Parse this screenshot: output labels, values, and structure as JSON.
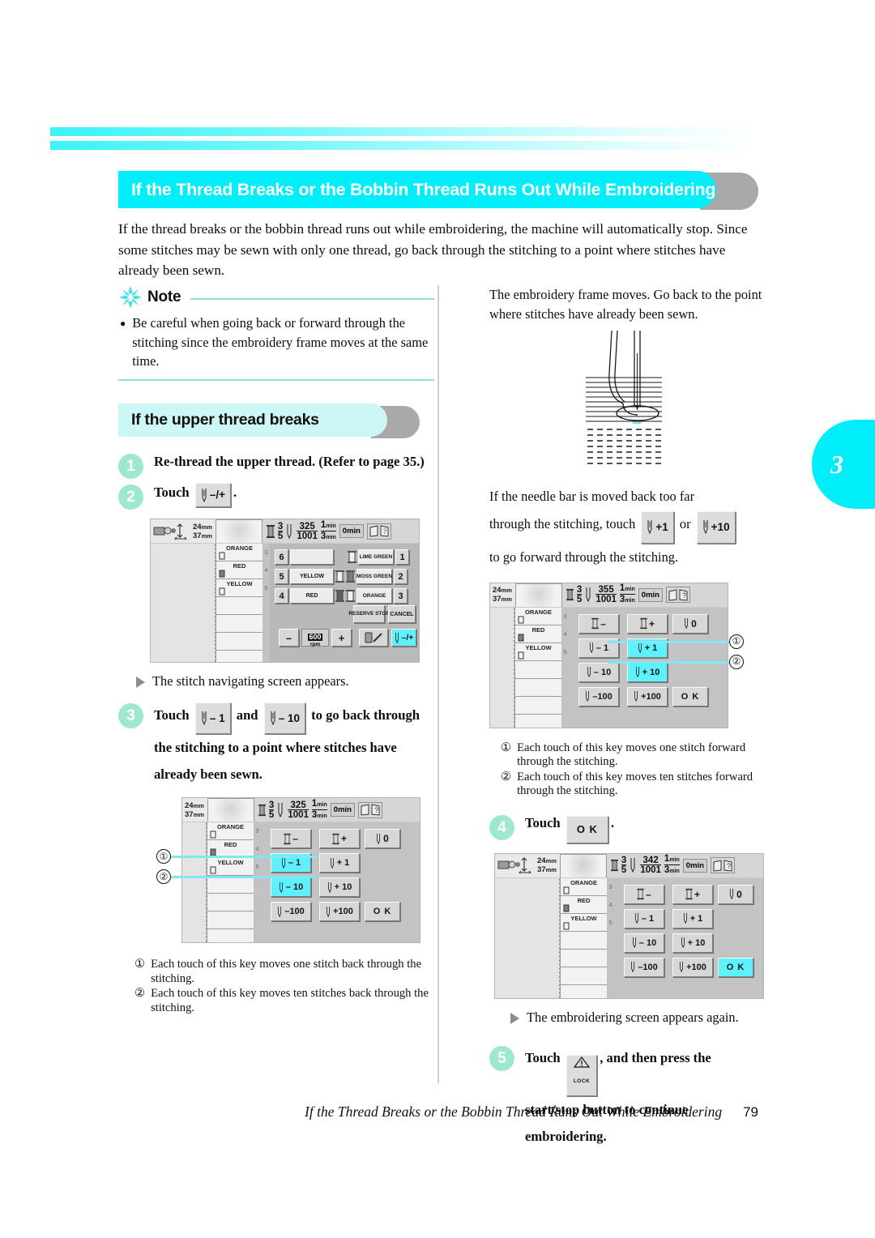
{
  "section": {
    "heading": "If the Thread Breaks or the Bobbin Thread Runs Out While Embroidering",
    "intro": "If the thread breaks or the bobbin thread runs out while embroidering, the machine will automatically stop. Since some stitches may be sewn with only one thread, go back through the stitching to a point where stitches have already been sewn."
  },
  "note": {
    "title": "Note",
    "bullet": "●",
    "text": "Be careful when going back or forward through the stitching since the embroidery frame moves at the same time."
  },
  "subsection": {
    "heading": "If the upper thread breaks"
  },
  "steps": {
    "one": {
      "num": "1",
      "text": "Re-thread the upper thread. (Refer to page 35.)"
    },
    "two": {
      "num": "2",
      "prefix": "Touch",
      "key": "–/+",
      "suffix": "."
    },
    "three": {
      "num": "3",
      "prefix": "Touch",
      "key_a": "– 1",
      "mid": "and",
      "key_b": "– 10",
      "suffix": "to go back through the stitching to a point where stitches have already been sewn."
    },
    "four": {
      "num": "4",
      "prefix": "Touch",
      "key": "O K",
      "suffix": "."
    },
    "five": {
      "num": "5",
      "prefix": "Touch",
      "key": "LOCK",
      "suffix": ", and then press the start/stop button to continue embroidering."
    }
  },
  "results": {
    "stitch_nav": "The stitch navigating screen appears.",
    "embroidering": "The embroidering screen appears again."
  },
  "right_text": {
    "frame_moves": "The embroidery frame moves. Go back to the point where stitches have already been sewn.",
    "too_far_a": "If the needle bar is moved back too far",
    "too_far_b_pre": "through the stitching, touch",
    "too_far_key_a": "+1",
    "too_far_or": "or",
    "too_far_key_b": "+10",
    "too_far_c": "to go forward through the stitching."
  },
  "captions": {
    "back": [
      {
        "num": "①",
        "text": "Each touch of this key moves one stitch back through the stitching."
      },
      {
        "num": "②",
        "text": "Each touch of this key moves ten stitches back through the stitching."
      }
    ],
    "forward": [
      {
        "num": "①",
        "text": "Each touch of this key moves one stitch forward through the stitching."
      },
      {
        "num": "②",
        "text": "Each touch of this key moves ten stitches forward through the stitching."
      }
    ]
  },
  "screens": {
    "embroidering": {
      "width_mm": "24",
      "height_mm": "37",
      "unit": "mm",
      "color_num": "3",
      "color_den": "5",
      "stitch_num": "325",
      "stitch_den": "1001",
      "time_num": "1",
      "time_den": "3",
      "time_unit_num": "min",
      "time_unit_den": "min",
      "elapsed": "0",
      "elapsed_unit": "min",
      "thread_list": [
        "ORANGE",
        "RED",
        "YELLOW"
      ],
      "thread_indexes": [
        "3",
        "4",
        "5"
      ],
      "needle_rows": [
        {
          "left_num": "6",
          "left_label": "",
          "right_label": "LIME GREEN",
          "right_num": "1"
        },
        {
          "left_num": "5",
          "left_label": "YELLOW",
          "right_label": "MOSS GREEN",
          "right_num": "2"
        },
        {
          "left_num": "4",
          "left_label": "RED",
          "right_label": "ORANGE",
          "right_num": "3"
        }
      ],
      "reserve_stop": "RESERVE STOP",
      "cancel": "CANCEL",
      "speed": "600",
      "speed_unit": "rpm",
      "minus": "–",
      "plus": "+",
      "nav_key": "–/+"
    },
    "nav_back": {
      "width_mm": "24",
      "height_mm": "37",
      "unit": "mm",
      "color_num": "3",
      "color_den": "5",
      "stitch_num": "325",
      "stitch_den": "1001",
      "time_num": "1",
      "time_den": "3",
      "elapsed": "0",
      "thread_list": [
        "ORANGE",
        "RED",
        "YELLOW"
      ],
      "thread_indexes": [
        "3",
        "4",
        "5"
      ],
      "keys": [
        [
          "–",
          "+",
          "0"
        ],
        [
          "– 1",
          "+ 1"
        ],
        [
          "– 10",
          "+ 10"
        ],
        [
          "–100",
          "+100"
        ]
      ],
      "ok": "O K",
      "highlighted": [
        "– 1",
        "– 10"
      ],
      "callouts": [
        "①",
        "②"
      ]
    },
    "nav_forward": {
      "width_mm": "24",
      "height_mm": "37",
      "unit": "mm",
      "color_num": "3",
      "color_den": "5",
      "stitch_num": "355",
      "stitch_den": "1001",
      "time_num": "1",
      "time_den": "3",
      "elapsed": "0",
      "thread_list": [
        "ORANGE",
        "RED",
        "YELLOW"
      ],
      "thread_indexes": [
        "3",
        "4",
        "5"
      ],
      "keys": [
        [
          "–",
          "+",
          "0"
        ],
        [
          "– 1",
          "+ 1"
        ],
        [
          "– 10",
          "+ 10"
        ],
        [
          "–100",
          "+100"
        ]
      ],
      "ok": "O K",
      "highlighted": [
        "+ 1",
        "+ 10"
      ],
      "callouts": [
        "①",
        "②"
      ]
    },
    "nav_ok": {
      "width_mm": "24",
      "height_mm": "37",
      "unit": "mm",
      "color_num": "3",
      "color_den": "5",
      "stitch_num": "342",
      "stitch_den": "1001",
      "time_num": "1",
      "time_den": "3",
      "elapsed": "0",
      "thread_list": [
        "ORANGE",
        "RED",
        "YELLOW"
      ],
      "thread_indexes": [
        "3",
        "4",
        "5"
      ],
      "keys": [
        [
          "–",
          "+",
          "0"
        ],
        [
          "– 1",
          "+ 1"
        ],
        [
          "– 10",
          "+ 10"
        ],
        [
          "–100",
          "+100"
        ]
      ],
      "ok": "O K",
      "highlighted": [
        "O K"
      ]
    }
  },
  "chapter_tab": "3",
  "footer": {
    "title": "If the Thread Breaks or the Bobbin Thread Runs Out While Embroidering",
    "page": "79"
  },
  "colors": {
    "cyan": "#00eef9",
    "light_cyan": "#cdf7f7",
    "mint": "#9ee8cf",
    "note_line": "#8fe3c8",
    "shadow_gray": "#a9a9a9",
    "key_highlight": "#5ef0fb"
  }
}
